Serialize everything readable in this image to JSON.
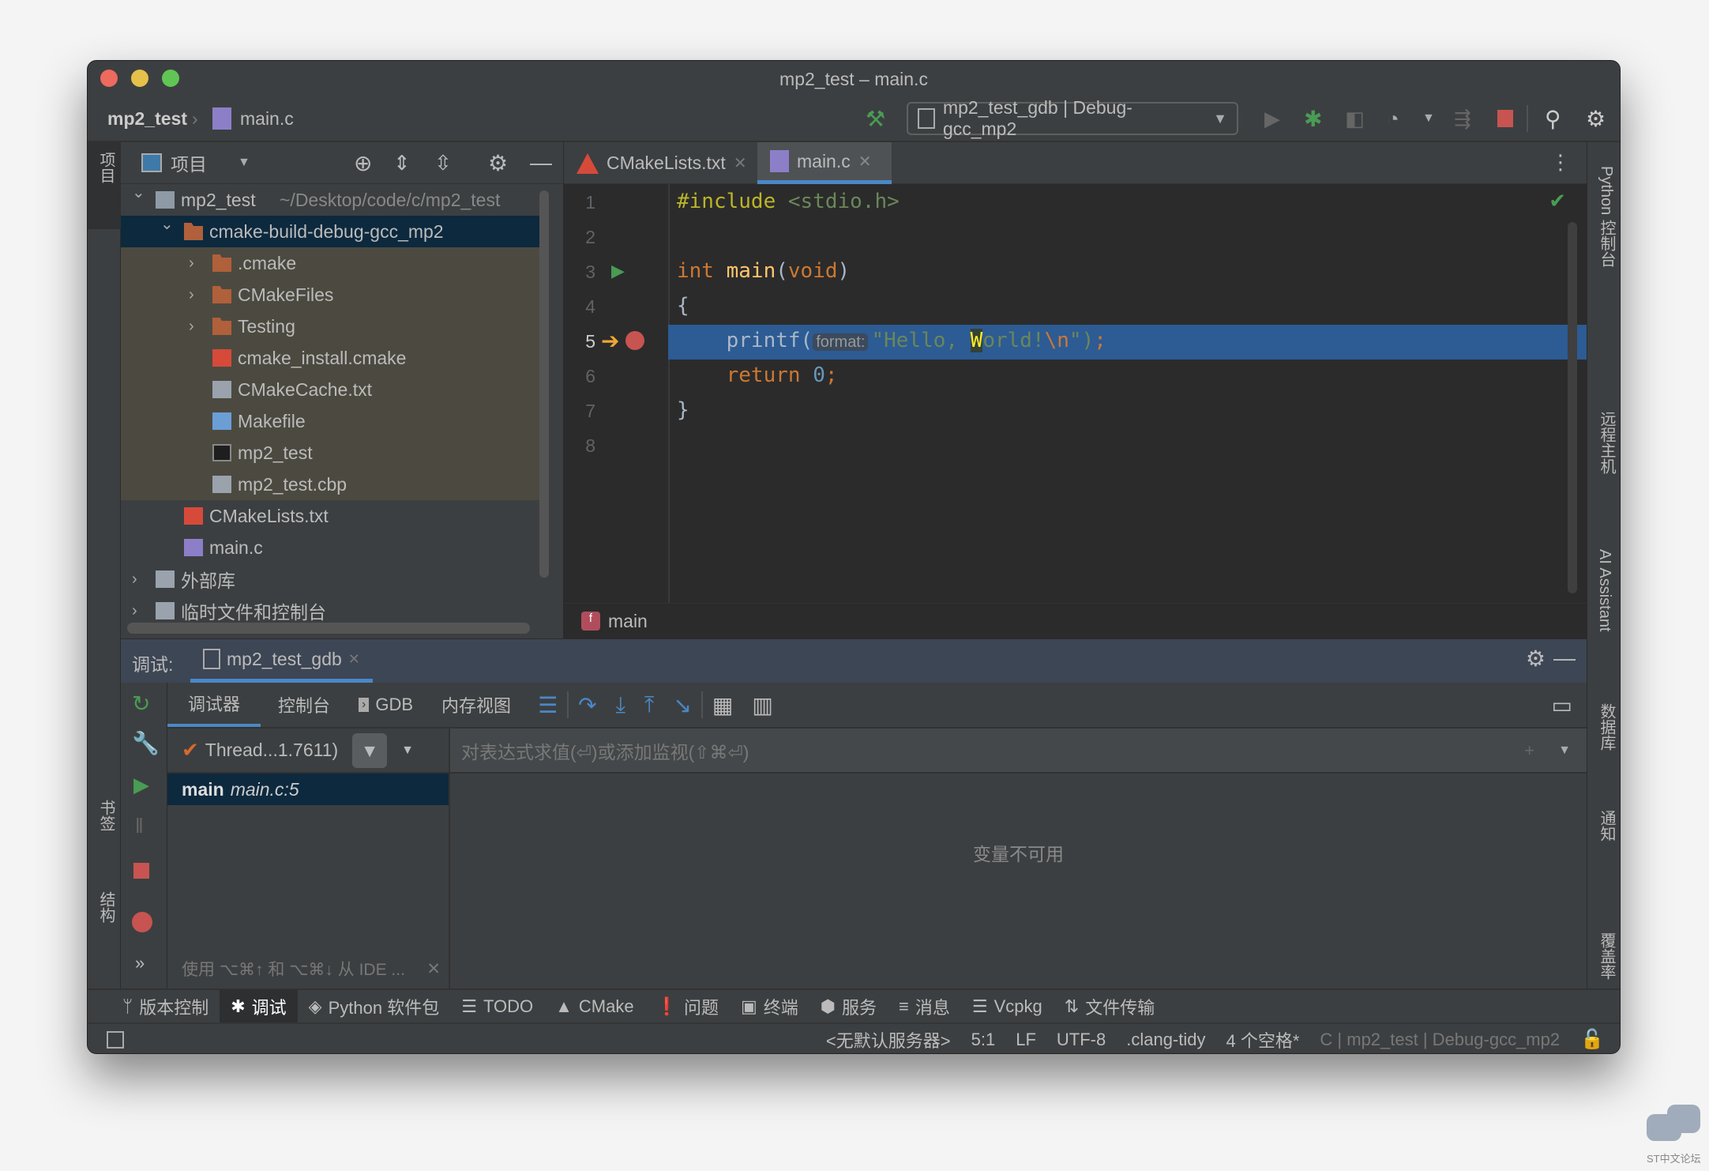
{
  "window": {
    "title": "mp2_test – main.c"
  },
  "nav": {
    "project": "mp2_test",
    "file": "main.c",
    "run_config": "mp2_test_gdb | Debug-gcc_mp2"
  },
  "colors": {
    "accent": "#4a88c7",
    "selection": "#214283",
    "highlight_line": "#2d5b94",
    "run_green": "#499c54",
    "stop_red": "#c75450",
    "folder_orange": "#b0603a"
  },
  "project_panel": {
    "title": "项目",
    "items": [
      {
        "label": "mp2_test",
        "path": "~/Desktop/code/c/mp2_test",
        "level": 0,
        "icon": "module-folder-icon",
        "expanded": true
      },
      {
        "label": "cmake-build-debug-gcc_mp2",
        "level": 1,
        "icon": "folder-icon",
        "expanded": true,
        "selected": true
      },
      {
        "label": ".cmake",
        "level": 2,
        "icon": "folder-icon",
        "expanded": false
      },
      {
        "label": "CMakeFiles",
        "level": 2,
        "icon": "folder-icon",
        "expanded": false
      },
      {
        "label": "Testing",
        "level": 2,
        "icon": "folder-icon",
        "expanded": false
      },
      {
        "label": "cmake_install.cmake",
        "level": 2,
        "icon": "cmake-icon"
      },
      {
        "label": "CMakeCache.txt",
        "level": 2,
        "icon": "cmake-cache-icon"
      },
      {
        "label": "Makefile",
        "level": 2,
        "icon": "makefile-icon"
      },
      {
        "label": "mp2_test",
        "level": 2,
        "icon": "executable-icon"
      },
      {
        "label": "mp2_test.cbp",
        "level": 2,
        "icon": "file-icon"
      },
      {
        "label": "CMakeLists.txt",
        "level": 1,
        "icon": "cmake-icon"
      },
      {
        "label": "main.c",
        "level": 1,
        "icon": "c-file-icon"
      },
      {
        "label": "外部库",
        "level": 0,
        "icon": "library-icon",
        "expanded": false
      },
      {
        "label": "临时文件和控制台",
        "level": 0,
        "icon": "scratch-icon",
        "expanded": false
      }
    ]
  },
  "editor": {
    "tabs": [
      {
        "label": "CMakeLists.txt",
        "active": false
      },
      {
        "label": "main.c",
        "active": true
      }
    ],
    "lines": [
      "1",
      "2",
      "3",
      "4",
      "5",
      "6",
      "7",
      "8"
    ],
    "code": {
      "l1a": "#include",
      "l1b": " <stdio.h>",
      "l3a": "int",
      "l3b": " main",
      "l3c": "(",
      "l3d": "void",
      "l3e": ")",
      "l4": "{",
      "l5a": "    printf(",
      "l5hint": "format:",
      "l5b": "\"Hello, ",
      "l5c": "W",
      "l5d": "orld!",
      "l5e": "\\n",
      "l5f": "\")",
      "l5g": ";",
      "l6a": "    return ",
      "l6b": "0",
      "l6c": ";",
      "l7": "}"
    },
    "current_line": "5",
    "breadcrumb": "main"
  },
  "debug": {
    "label": "调试:",
    "session": "mp2_test_gdb",
    "tabs": [
      "调试器",
      "控制台",
      "GDB",
      "内存视图"
    ],
    "thread": "Thread...1.7611)",
    "frame_name": "main",
    "frame_loc": "main.c:5",
    "eval_placeholder": "对表达式求值(⏎)或添加监视(⇧⌘⏎)",
    "empty": "变量不可用",
    "hint": "使用 ⌥⌘↑ 和 ⌥⌘↓ 从 IDE ..."
  },
  "left_strip": [
    "项目",
    "书签",
    "结构"
  ],
  "right_strip": [
    "Python 控制台",
    "远程主机",
    "AI Assistant",
    "数据库",
    "通知",
    "覆盖率"
  ],
  "tool_windows": [
    "版本控制",
    "调试",
    "Python 软件包",
    "TODO",
    "CMake",
    "问题",
    "终端",
    "服务",
    "消息",
    "Vcpkg",
    "文件传输"
  ],
  "status": {
    "server": "<无默认服务器>",
    "pos": "5:1",
    "eol": "LF",
    "enc": "UTF-8",
    "lint": ".clang-tidy",
    "indent": "4 个空格*",
    "context": "C | mp2_test | Debug-gcc_mp2"
  },
  "watermark": "ST中文论坛"
}
